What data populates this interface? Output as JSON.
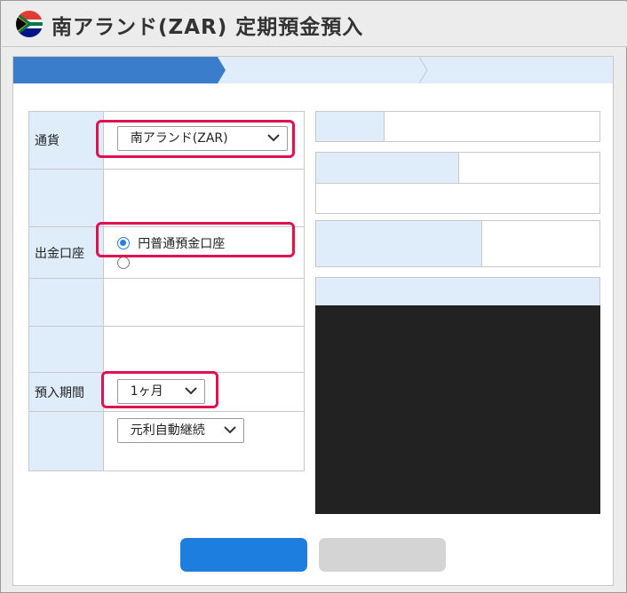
{
  "header": {
    "title": "南アランド(ZAR) 定期預金預入",
    "flag_icon": "south-africa-flag-icon"
  },
  "steps": {
    "count": 3,
    "active_index": 0,
    "active_color": "#3a7ecb",
    "inactive_color": "#dfecfa"
  },
  "form": {
    "currency": {
      "label": "通貨",
      "selected": "南アランド(ZAR)"
    },
    "withdrawal_account": {
      "label": "出金口座",
      "options": [
        {
          "label": "円普通預金口座",
          "checked": true
        },
        {
          "label": "",
          "checked": false
        }
      ]
    },
    "deposit_period": {
      "label": "預入期間",
      "selected": "1ヶ月"
    },
    "maturity": {
      "selected": "元利自動継続"
    }
  },
  "colors": {
    "highlight": "#e0114f",
    "label_bg": "#dfecfa",
    "primary_button": "#1e7ee0",
    "secondary_button": "#d4d4d4",
    "dark_area": "#222222"
  },
  "buttons": {
    "primary_label": "",
    "secondary_label": ""
  }
}
